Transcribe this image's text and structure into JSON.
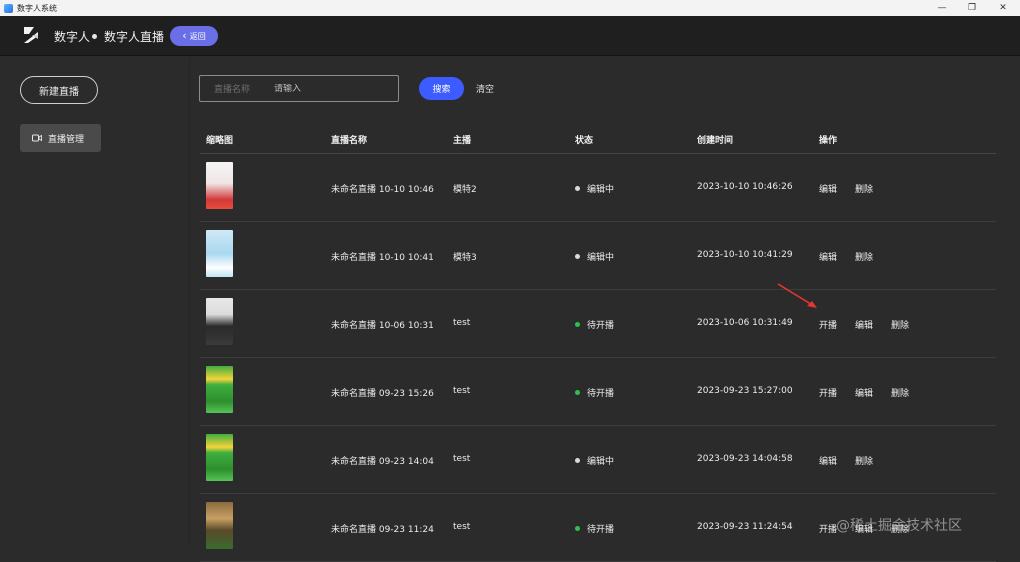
{
  "window": {
    "title": "数字人系统",
    "minimize": "—",
    "maximize": "❐",
    "close": "✕"
  },
  "header": {
    "crumb1": "数字人",
    "crumb2": "数字人直播",
    "back_label": "返回",
    "back_chevron": "‹"
  },
  "sidebar": {
    "new_live_label": "新建直播",
    "menu_label": "直播管理"
  },
  "search": {
    "label": "直播名称",
    "placeholder": "请输入",
    "search_label": "搜索",
    "clear_label": "清空"
  },
  "table": {
    "columns": [
      "缩略图",
      "直播名称",
      "主播",
      "状态",
      "创建时间",
      "操作"
    ],
    "rows": [
      {
        "name": "未命名直播 10-10 10:46",
        "anchor": "模特2",
        "status": "编辑中",
        "status_color": "#d9d9d9",
        "created": "2023-10-10 10:46:26",
        "actions": [
          "编辑",
          "删除"
        ],
        "thumb": "red"
      },
      {
        "name": "未命名直播 10-10 10:41",
        "anchor": "模特3",
        "status": "编辑中",
        "status_color": "#d9d9d9",
        "created": "2023-10-10 10:41:29",
        "actions": [
          "编辑",
          "删除"
        ],
        "thumb": "blue"
      },
      {
        "name": "未命名直播 10-06 10:31",
        "anchor": "test",
        "status": "待开播",
        "status_color": "#2fbf4a",
        "created": "2023-10-06 10:31:49",
        "actions": [
          "开播",
          "编辑",
          "删除"
        ],
        "thumb": "man"
      },
      {
        "name": "未命名直播 09-23 15:26",
        "anchor": "test",
        "status": "待开播",
        "status_color": "#2fbf4a",
        "created": "2023-09-23 15:27:00",
        "actions": [
          "开播",
          "编辑",
          "删除"
        ],
        "thumb": "green"
      },
      {
        "name": "未命名直播 09-23 14:04",
        "anchor": "test",
        "status": "编辑中",
        "status_color": "#d9d9d9",
        "created": "2023-09-23 14:04:58",
        "actions": [
          "编辑",
          "删除"
        ],
        "thumb": "green"
      },
      {
        "name": "未命名直播 09-23 11:24",
        "anchor": "test",
        "status": "待开播",
        "status_color": "#2fbf4a",
        "created": "2023-09-23 11:24:54",
        "actions": [
          "开播",
          "编辑",
          "删除"
        ],
        "thumb": "food"
      }
    ]
  },
  "watermark": "@稀土掘金技术社区",
  "colors": {
    "accent": "#3d5cff",
    "back_button": "#6a6fe8",
    "arrow": "#e8352e"
  }
}
